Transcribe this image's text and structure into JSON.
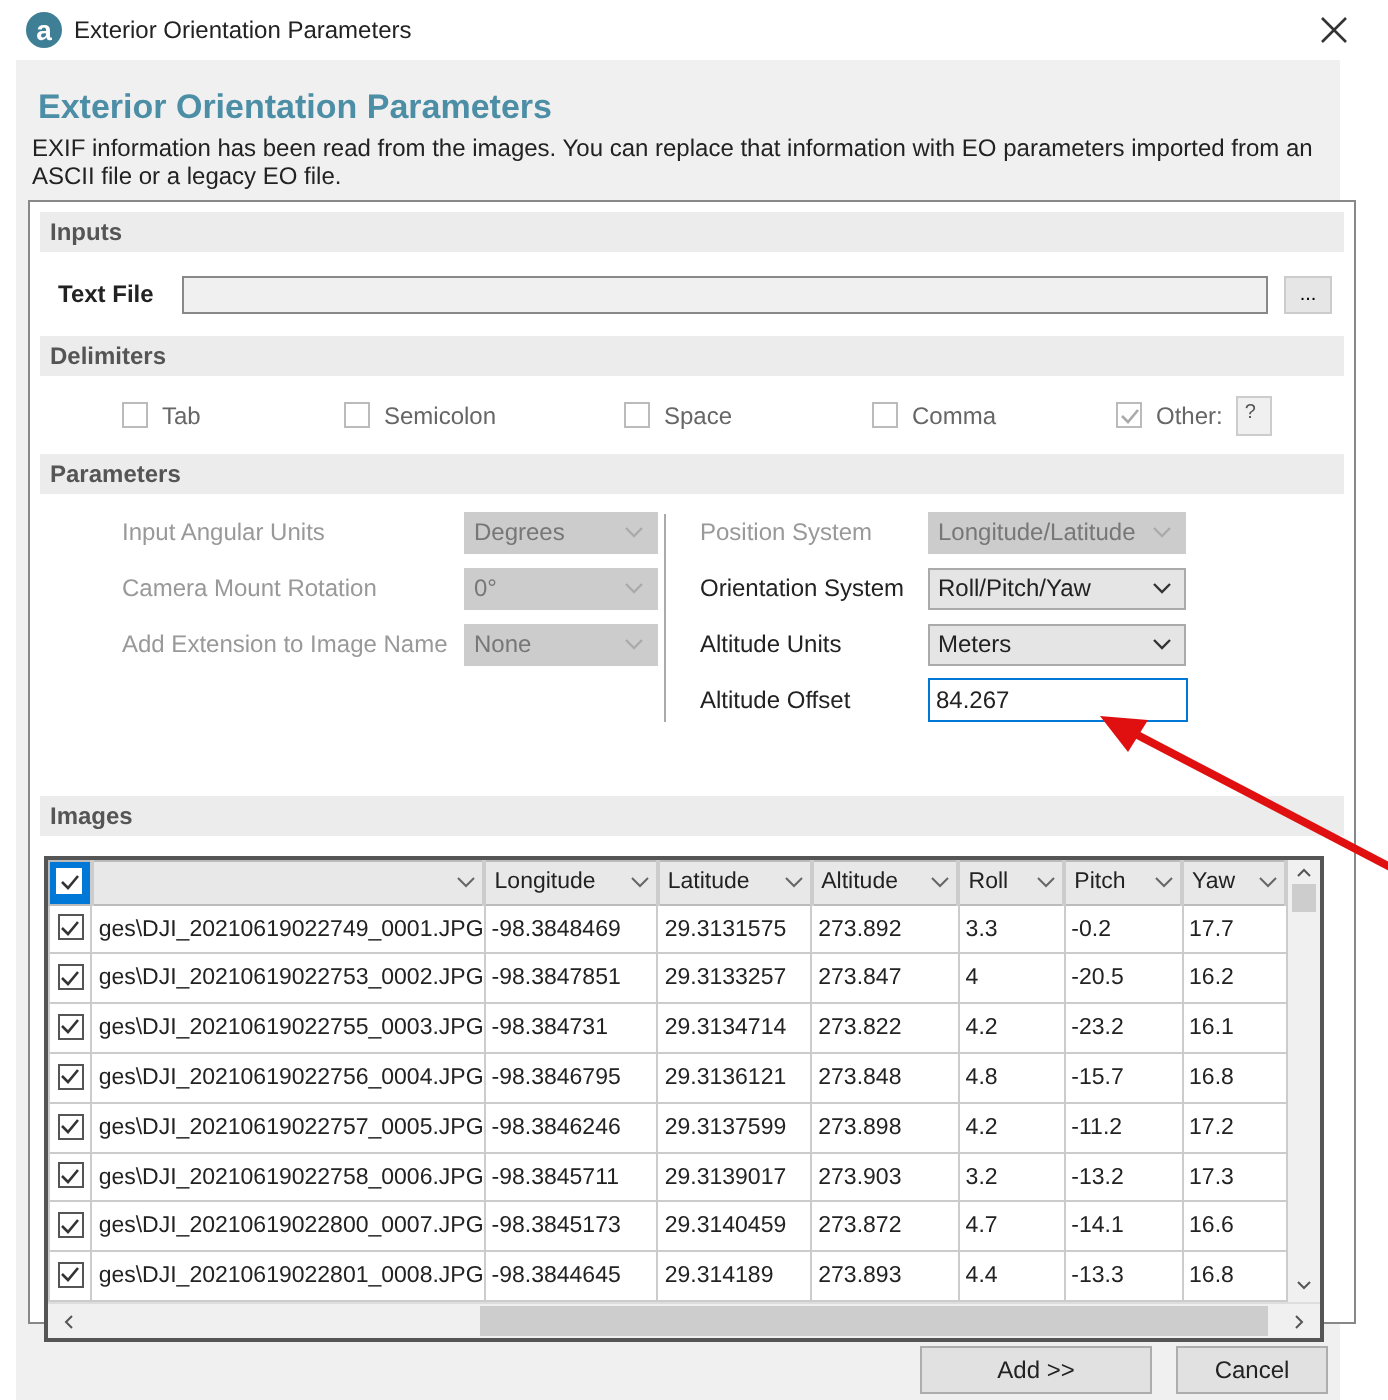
{
  "window": {
    "logo_letter": "a",
    "title": "Exterior Orientation Parameters"
  },
  "heading": "Exterior Orientation Parameters",
  "description": "EXIF information has been read from the images. You can replace that information with EO parameters imported from an ASCII file or a legacy EO file.",
  "inputs": {
    "label": "Inputs",
    "text_file_label": "Text File",
    "browse_button": "..."
  },
  "delimiters": {
    "label": "Delimiters",
    "options": [
      {
        "label": "Tab",
        "checked": false,
        "disabled": true
      },
      {
        "label": "Semicolon",
        "checked": false,
        "disabled": true
      },
      {
        "label": "Space",
        "checked": false,
        "disabled": true
      },
      {
        "label": "Comma",
        "checked": false,
        "disabled": true
      },
      {
        "label": "Other:",
        "checked": true,
        "disabled": true
      }
    ],
    "other_value": "?"
  },
  "parameters": {
    "label": "Parameters",
    "left": [
      {
        "label": "Input Angular Units",
        "value": "Degrees",
        "disabled": true
      },
      {
        "label": "Camera Mount Rotation",
        "value": "0°",
        "disabled": true
      },
      {
        "label": "Add Extension to Image Name",
        "value": "None",
        "disabled": true
      }
    ],
    "right": [
      {
        "kind": "dropdown",
        "label": "Position System",
        "value": "Longitude/Latitude",
        "disabled": true
      },
      {
        "kind": "dropdown",
        "label": "Orientation System",
        "value": "Roll/Pitch/Yaw",
        "disabled": false
      },
      {
        "kind": "dropdown",
        "label": "Altitude Units",
        "value": "Meters",
        "disabled": false
      },
      {
        "kind": "field",
        "label": "Altitude Offset",
        "value": "84.267",
        "disabled": false
      }
    ]
  },
  "images": {
    "label": "Images",
    "all_checked": true,
    "columns": [
      "",
      "Longitude",
      "Latitude",
      "Altitude",
      "Roll",
      "Pitch",
      "Yaw"
    ],
    "rows": [
      {
        "checked": true,
        "cells": [
          "ges\\DJI_20210619022749_0001.JPG",
          "-98.3848469",
          "29.3131575",
          "273.892",
          "3.3",
          "-0.2",
          "17.7"
        ]
      },
      {
        "checked": true,
        "cells": [
          "ges\\DJI_20210619022753_0002.JPG",
          "-98.3847851",
          "29.3133257",
          "273.847",
          "4",
          "-20.5",
          "16.2"
        ]
      },
      {
        "checked": true,
        "cells": [
          "ges\\DJI_20210619022755_0003.JPG",
          "-98.384731",
          "29.3134714",
          "273.822",
          "4.2",
          "-23.2",
          "16.1"
        ]
      },
      {
        "checked": true,
        "cells": [
          "ges\\DJI_20210619022756_0004.JPG",
          "-98.3846795",
          "29.3136121",
          "273.848",
          "4.8",
          "-15.7",
          "16.8"
        ]
      },
      {
        "checked": true,
        "cells": [
          "ges\\DJI_20210619022757_0005.JPG",
          "-98.3846246",
          "29.3137599",
          "273.898",
          "4.2",
          "-11.2",
          "17.2"
        ]
      },
      {
        "checked": true,
        "cells": [
          "ges\\DJI_20210619022758_0006.JPG",
          "-98.3845711",
          "29.3139017",
          "273.903",
          "3.2",
          "-13.2",
          "17.3"
        ]
      },
      {
        "checked": true,
        "cells": [
          "ges\\DJI_20210619022800_0007.JPG",
          "-98.3845173",
          "29.3140459",
          "273.872",
          "4.7",
          "-14.1",
          "16.6"
        ]
      },
      {
        "checked": true,
        "cells": [
          "ges\\DJI_20210619022801_0008.JPG",
          "-98.3844645",
          "29.314189",
          "273.893",
          "4.4",
          "-13.3",
          "16.8"
        ]
      }
    ]
  },
  "buttons": [
    "Add >>",
    "Cancel"
  ]
}
